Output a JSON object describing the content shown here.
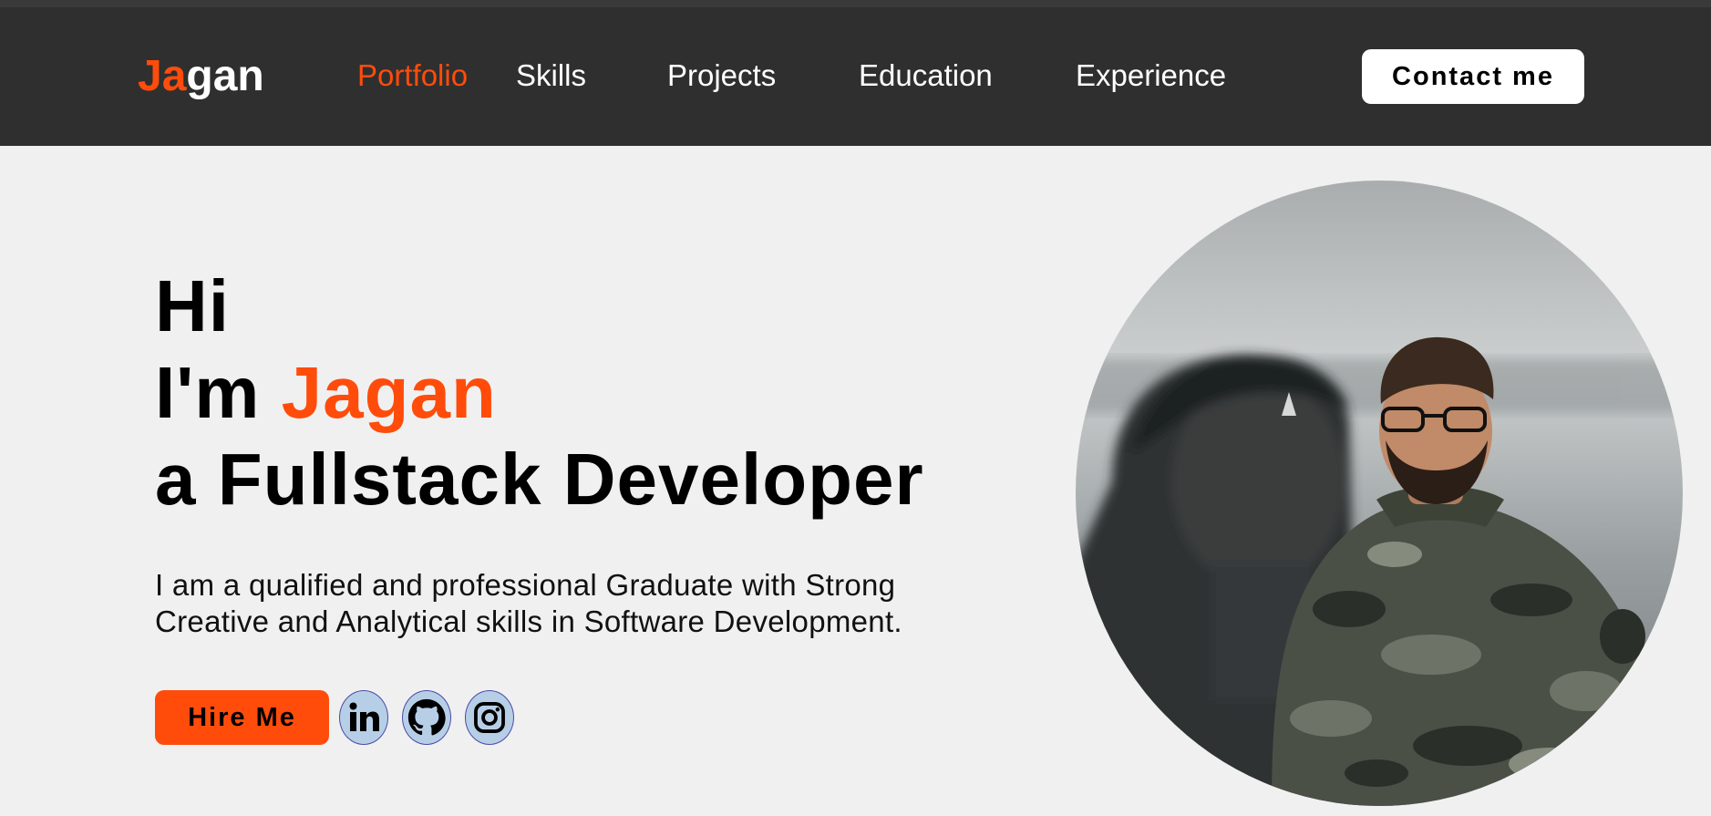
{
  "brand": {
    "logo_accent": "Ja",
    "logo_rest": "gan"
  },
  "nav": {
    "items": [
      {
        "label": "Portfolio",
        "active": true
      },
      {
        "label": "Skills",
        "active": false
      },
      {
        "label": "Projects",
        "active": false
      },
      {
        "label": "Education",
        "active": false
      },
      {
        "label": "Experience",
        "active": false
      }
    ],
    "contact_label": "Contact me"
  },
  "hero": {
    "line1": "Hi",
    "line2_prefix": "I'm ",
    "line2_name": "Jagan",
    "line3": "a Fullstack Developer",
    "description": "I am a qualified and professional Graduate with Strong Creative and Analytical skills in Software Development.",
    "hire_label": "Hire Me",
    "socials": [
      "linkedin-icon",
      "github-icon",
      "instagram-icon"
    ]
  },
  "colors": {
    "accent": "#ff4c0b",
    "navbar": "#2f2f2f",
    "page_bg": "#f0f0f0",
    "social_bg": "#b7cfe6"
  }
}
